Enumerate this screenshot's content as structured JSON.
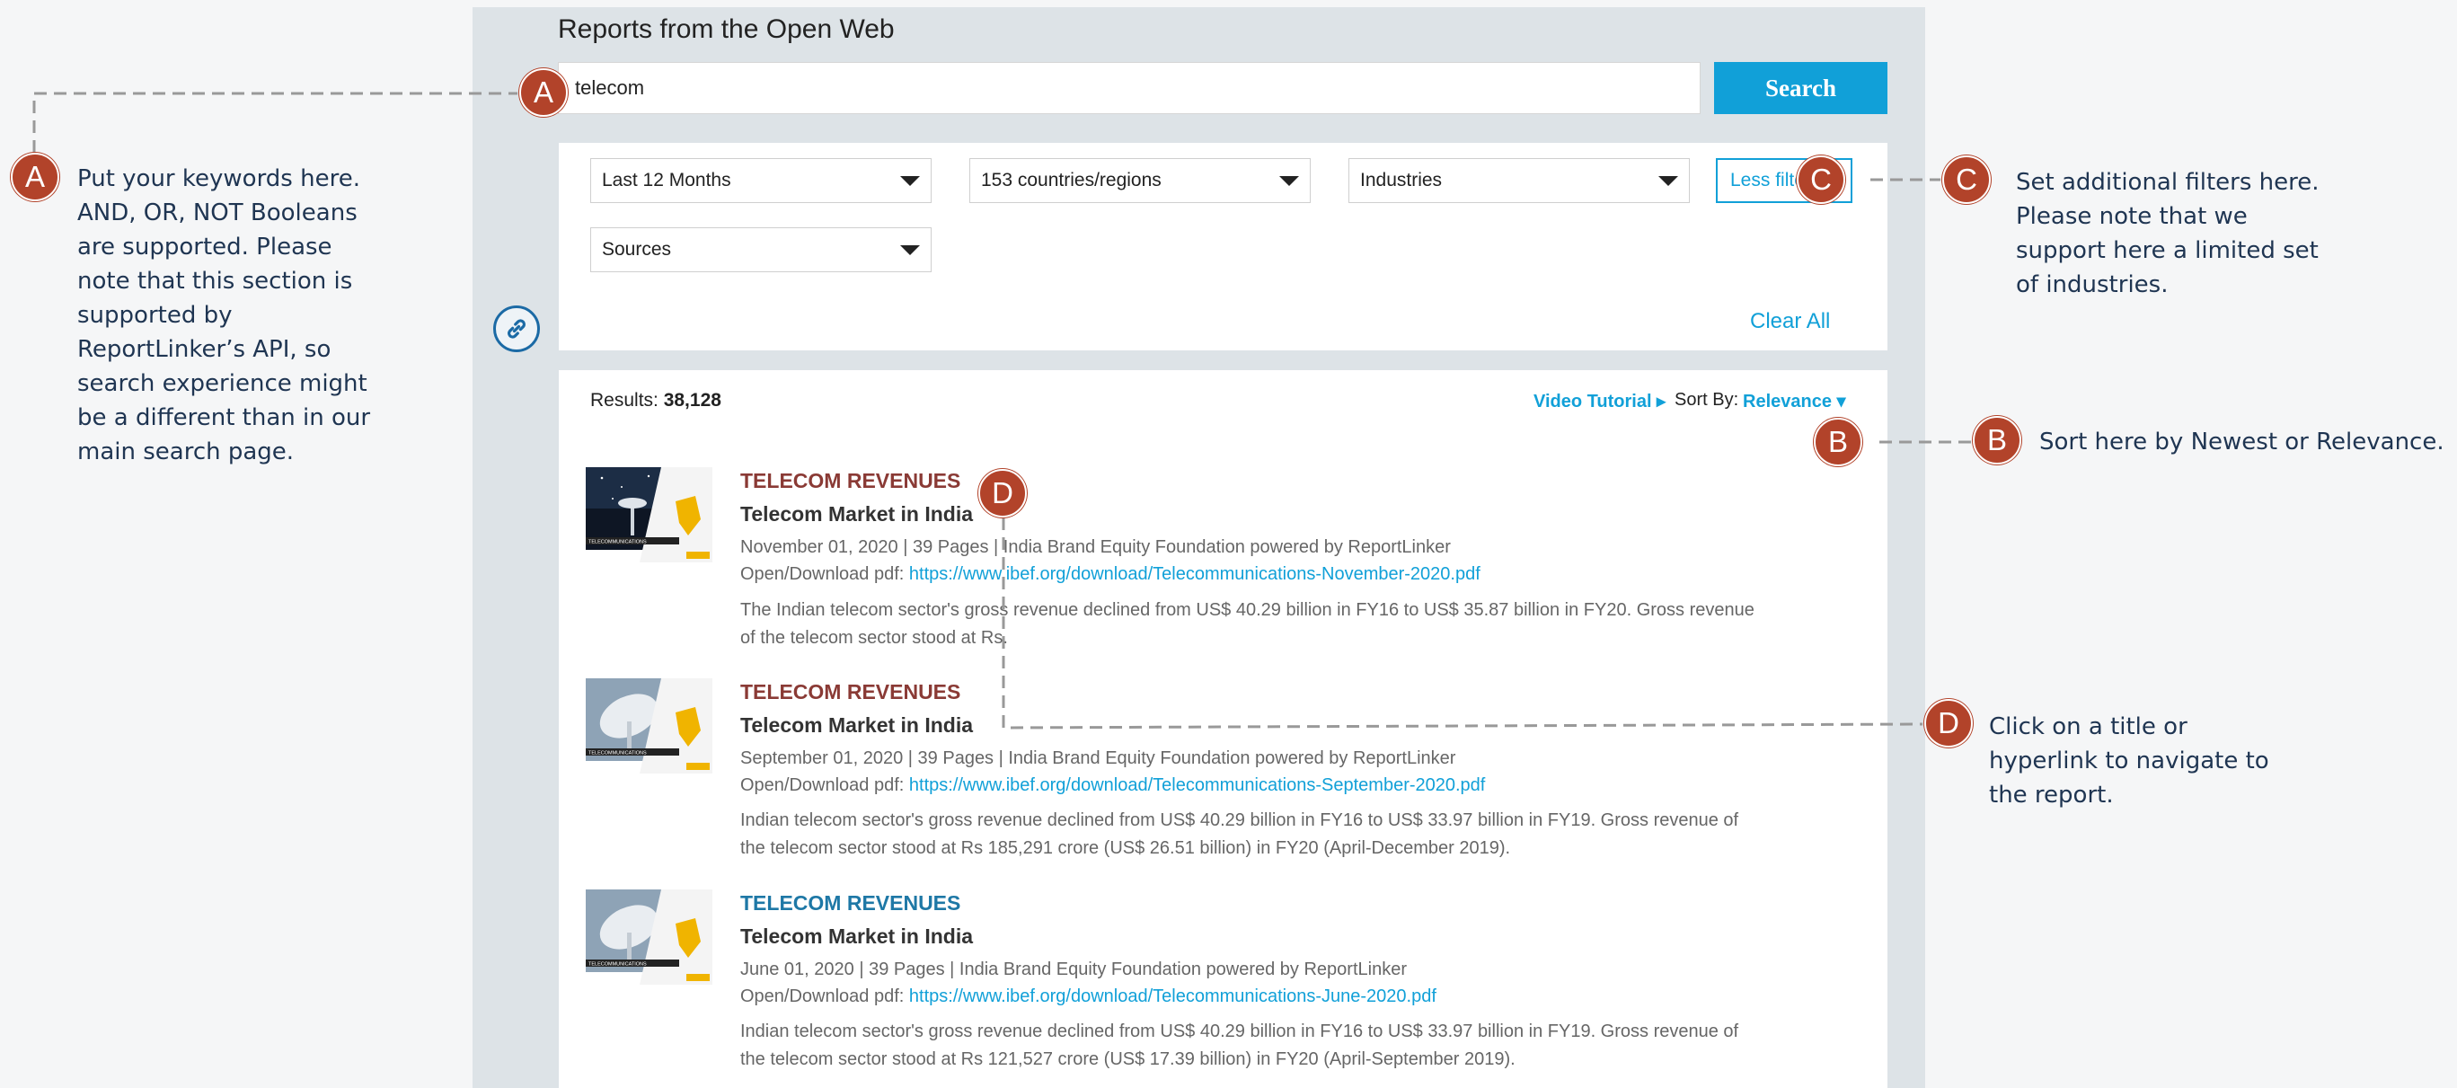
{
  "panel_title": "Reports from the Open Web",
  "search": {
    "value": "telecom",
    "placeholder": "",
    "button": "Search"
  },
  "filters": {
    "period": "Last 12 Months",
    "regions": "153 countries/regions",
    "industries": "Industries",
    "sources": "Sources",
    "less_filters": "Less filters",
    "clear_all": "Clear All"
  },
  "results": {
    "label": "Results: ",
    "count": "38,128",
    "video_tutorial": "Video Tutorial ▸",
    "sort_label": "Sort By:",
    "sort_value": "Relevance ▾",
    "items": [
      {
        "category": "TELECOM REVENUES",
        "category_color": "#8a3a35",
        "title": "Telecom Market in India",
        "meta": "November 01, 2020 | 39 Pages | India Brand Equity Foundation powered by ReportLinker",
        "link_label": "Open/Download pdf: ",
        "link": "https://www.ibef.org/download/Telecommunications-November-2020.pdf",
        "description": "The Indian telecom sector's gross revenue declined from US$ 40.29 billion in FY16 to US$ 35.87 billion in FY20. Gross revenue of the telecom sector stood at Rs."
      },
      {
        "category": "TELECOM REVENUES",
        "category_color": "#8a3a35",
        "title": "Telecom Market in India",
        "meta": "September 01, 2020 | 39 Pages | India Brand Equity Foundation powered by ReportLinker",
        "link_label": "Open/Download pdf: ",
        "link": "https://www.ibef.org/download/Telecommunications-September-2020.pdf",
        "description": "Indian telecom sector's gross revenue declined from US$ 40.29 billion in FY16 to US$ 33.97 billion in FY19. Gross revenue of the telecom sector stood at Rs 185,291 crore (US$ 26.51 billion) in FY20 (April-December 2019)."
      },
      {
        "category": "TELECOM REVENUES",
        "category_color": "#1e78a6",
        "title": "Telecom Market in India",
        "meta": "June 01, 2020 | 39 Pages | India Brand Equity Foundation powered by ReportLinker",
        "link_label": "Open/Download pdf: ",
        "link": "https://www.ibef.org/download/Telecommunications-June-2020.pdf",
        "description": "Indian telecom sector's gross revenue declined from US$ 40.29 billion in FY16 to US$ 33.97 billion in FY19. Gross revenue of the telecom sector stood at Rs 121,527 crore (US$ 17.39 billion) in FY20 (April-September 2019)."
      }
    ]
  },
  "annotations": {
    "badge_a": "A",
    "badge_b": "B",
    "badge_c": "C",
    "badge_d": "D",
    "note_a": "Put your keywords here. AND, OR, NOT Booleans are supported. Please note that this section is supported by ReportLinker’s API, so search experience might be a different than in our main search page.",
    "note_b": "Sort here by Newest or Relevance.",
    "note_c": "Set additional filters here. Please note that we support here a limited set of industries.",
    "note_d": "Click on a title or hyperlink to navigate to the report."
  },
  "colors": {
    "accent": "#11a0d8",
    "badge": "#b2432a",
    "panel": "#dde3e7",
    "note_text": "#1f3552"
  }
}
